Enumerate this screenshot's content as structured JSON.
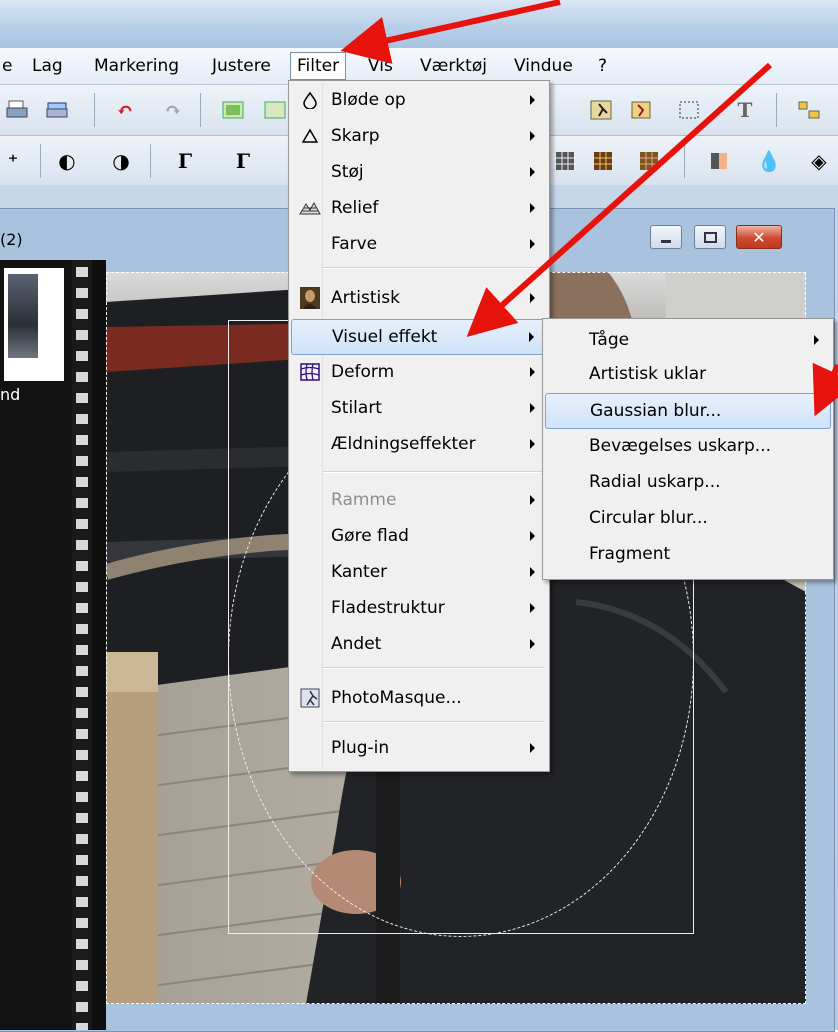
{
  "menubar": {
    "items": [
      {
        "label": "e"
      },
      {
        "label": "Lag"
      },
      {
        "label": "Markering"
      },
      {
        "label": "Justere"
      },
      {
        "label": "Filter"
      },
      {
        "label": "Vis"
      },
      {
        "label": "Værktøj"
      },
      {
        "label": "Vindue"
      },
      {
        "label": "?"
      }
    ],
    "active": "Filter"
  },
  "document": {
    "title": "(2)",
    "thumbnail_label": "nd",
    "window_buttons": [
      "minimize",
      "restore",
      "close"
    ]
  },
  "filter_menu": {
    "items": [
      {
        "label": "Bløde op",
        "icon": "drop-outline-icon",
        "submenu": true
      },
      {
        "label": "Skarp",
        "icon": "triangle-outline-icon",
        "submenu": true
      },
      {
        "label": "Støj",
        "submenu": true
      },
      {
        "label": "Relief",
        "icon": "relief-icon",
        "submenu": true
      },
      {
        "label": "Farve",
        "submenu": true
      },
      {
        "label": "Artistisk",
        "icon": "mona-lisa-icon",
        "submenu": true
      },
      {
        "label": "Visuel effekt",
        "submenu": true,
        "highlighted": true
      },
      {
        "label": "Deform",
        "icon": "grid-deform-icon",
        "submenu": true
      },
      {
        "label": "Stilart",
        "submenu": true
      },
      {
        "label": "Ældningseffekter",
        "submenu": true
      },
      {
        "label": "Ramme",
        "submenu": true,
        "disabled": true
      },
      {
        "label": "Gøre flad",
        "submenu": true
      },
      {
        "label": "Kanter",
        "submenu": true
      },
      {
        "label": "Fladestruktur",
        "submenu": true
      },
      {
        "label": "Andet",
        "submenu": true
      },
      {
        "label": "PhotoMasque...",
        "icon": "photomasque-icon"
      },
      {
        "label": "Plug-in",
        "submenu": true
      }
    ]
  },
  "visual_effect_submenu": {
    "items": [
      {
        "label": "Tåge",
        "submenu": true
      },
      {
        "label": "Artistisk uklar"
      },
      {
        "label": "Gaussian blur...",
        "highlighted": true
      },
      {
        "label": "Bevægelses uskarp..."
      },
      {
        "label": "Radial uskarp..."
      },
      {
        "label": "Circular blur..."
      },
      {
        "label": "Fragment"
      }
    ]
  },
  "colors": {
    "annotation_arrow": "#e8120c",
    "menu_highlight": "#cfe3f9",
    "menu_highlight_border": "#7da2ce"
  }
}
